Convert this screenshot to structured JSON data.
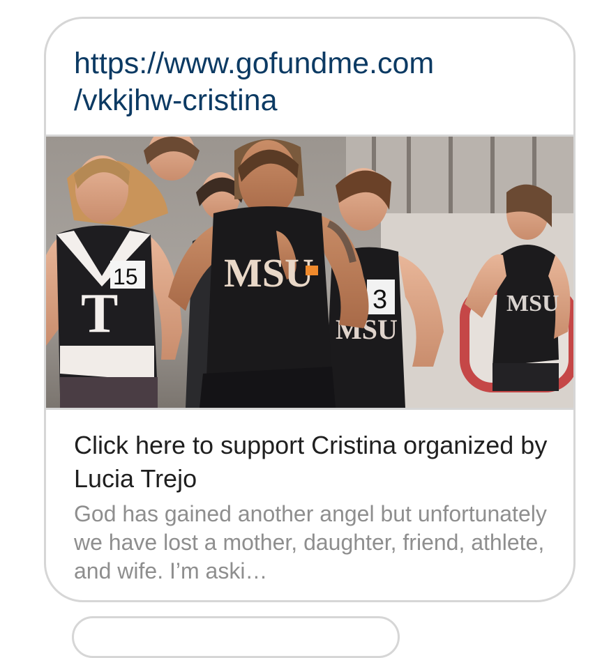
{
  "link_preview": {
    "url": "https://www.gofundme.com\n/vkkjhw-cristina",
    "image_alt": "Runners racing in a track meet",
    "jersey_labels": {
      "left_runner_letter": "T",
      "left_runner_number": "15",
      "center_runner_text": "MSU",
      "right_runner_number": "3",
      "right_runner_text": "MSU",
      "far_right_runner_text": "MSU"
    },
    "title": "Click here to support Cristina organized by Lucia Trejo",
    "description": "God has gained another angel but unfortunately we have lost a mother, daughter, friend, athlete, and wife. I’m aski…"
  }
}
